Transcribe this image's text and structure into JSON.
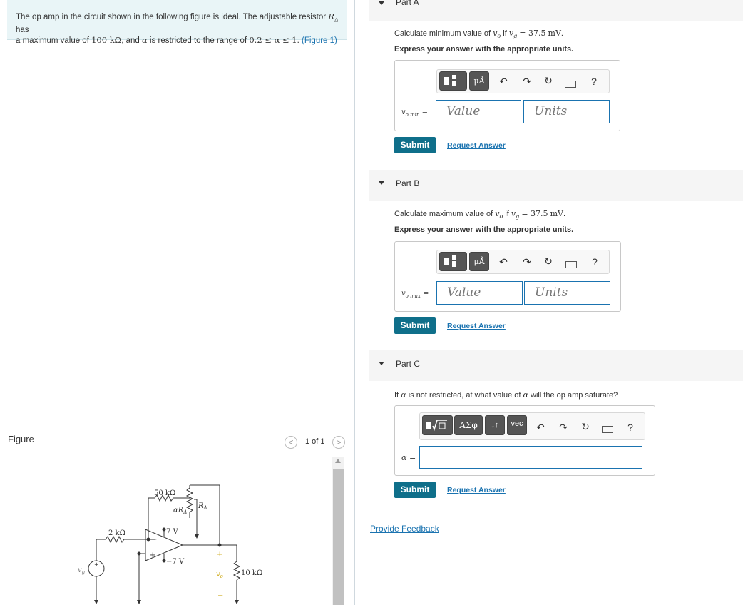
{
  "problem": {
    "text_1": "The op amp in the circuit shown in the following figure is ideal. The adjustable resistor",
    "ra": "R",
    "ra_sub": "Δ",
    "text_2": "has",
    "text_3": "a maximum value of",
    "max_value": "100 kΩ",
    "text_4": ", and",
    "alpha": "α",
    "text_5": "is restricted to the range of",
    "range": "0.2 ≤ α ≤ 1",
    "text_6": ".",
    "figure_link": "(Figure 1)"
  },
  "figure": {
    "label": "Figure",
    "pager": "1 of 1",
    "prev": "<",
    "next": ">",
    "circuit": {
      "r_feedback": "50 kΩ",
      "r_input": "2 kΩ",
      "r_alpha": "αR",
      "r_alpha_sub": "Δ",
      "r_delta": "R",
      "r_delta_sub": "Δ",
      "v_pos": "7 V",
      "v_neg": "−7 V",
      "vg": "v",
      "vg_sub": "g",
      "vo": "v",
      "vo_sub": "o",
      "r_load": "10 kΩ",
      "plus": "+",
      "minus": "−"
    }
  },
  "partA": {
    "title": "Part A",
    "question_pre": "Calculate minimum value of",
    "question_var": "v",
    "question_var_sub": "o",
    "question_mid": "if",
    "question_cond": "v",
    "question_cond_sub": "g",
    "question_eq": "= 37.5",
    "question_unit": "mV",
    "question_end": ".",
    "instruction": "Express your answer with the appropriate units.",
    "var_label": "v",
    "var_sub": "o min",
    "eq": "=",
    "value_placeholder": "Value",
    "units_placeholder": "Units",
    "submit": "Submit",
    "request": "Request Answer"
  },
  "partB": {
    "title": "Part B",
    "question_pre": "Calculate maximum value of",
    "question_var": "v",
    "question_var_sub": "o",
    "question_mid": "if",
    "question_cond": "v",
    "question_cond_sub": "g",
    "question_eq": "= 37.5",
    "question_unit": "mV",
    "question_end": ".",
    "instruction": "Express your answer with the appropriate units.",
    "var_label": "v",
    "var_sub": "o max",
    "eq": "=",
    "value_placeholder": "Value",
    "units_placeholder": "Units",
    "submit": "Submit",
    "request": "Request Answer"
  },
  "partC": {
    "title": "Part C",
    "question_pre": "If",
    "question_alpha": "α",
    "question_mid": "is not restricted, at what value of",
    "question_alpha2": "α",
    "question_end": "will the op amp saturate?",
    "var_label": "α",
    "eq": "=",
    "submit": "Submit",
    "request": "Request Answer",
    "toolbar_greek": "ΑΣφ",
    "toolbar_arrows": "↓↑",
    "toolbar_vec": "vec"
  },
  "toolbar": {
    "units_btn": "μÅ",
    "help": "?"
  },
  "feedback": "Provide Feedback",
  "colors": {
    "accent": "#0f6f8a",
    "link": "#1a73b0",
    "problem_bg": "#e9f5f7"
  }
}
